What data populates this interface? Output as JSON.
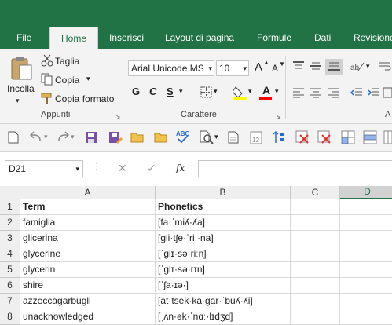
{
  "ribbon_tabs": [
    "File",
    "Home",
    "Inserisci",
    "Layout di pagina",
    "Formule",
    "Dati",
    "Revisione"
  ],
  "clipboard": {
    "paste_label": "Incolla",
    "cut_label": "Taglia",
    "copy_label": "Copia",
    "format_painter_label": "Copia formato",
    "group_label": "Appunti"
  },
  "font": {
    "name": "Arial Unicode MS",
    "size": "10",
    "bold": "G",
    "italic": "C",
    "underline": "S",
    "grow": "A",
    "shrink": "A",
    "color_letter": "A",
    "group_label": "Carattere"
  },
  "group_label_partial": "A",
  "formula_bar": {
    "name_box": "D21",
    "fx_label": "fx",
    "value": ""
  },
  "sheet": {
    "columns": [
      "A",
      "B",
      "C",
      "D"
    ],
    "selected_column": "D",
    "rows": [
      {
        "num": "1",
        "a": "Term",
        "b": "Phonetics"
      },
      {
        "num": "2",
        "a": "famiglia",
        "b": "[fa·ˈmiʎ·ʎa]"
      },
      {
        "num": "3",
        "a": "glicerina",
        "b": "[gli·tʃe·ˈriː·na]"
      },
      {
        "num": "4",
        "a": "glycerine",
        "b": "[ˈglɪ·sə·riːn]"
      },
      {
        "num": "5",
        "a": "glycerin",
        "b": "[ˈglɪ·sə·rɪn]"
      },
      {
        "num": "6",
        "a": "shire",
        "b": "[ˈʃa·ɪə·]"
      },
      {
        "num": "7",
        "a": "azzeccagarbugli",
        "b": "[at·tsek·ka·gar·ˈbuʎ·ʎi]"
      },
      {
        "num": "8",
        "a": "unacknowledged",
        "b": "[ˌʌn·ək·ˈnɑː·lɪdʒd]"
      }
    ]
  },
  "colors": {
    "excel_green": "#217346",
    "fill_yellow": "#ffff00",
    "font_red": "#ff0000"
  }
}
